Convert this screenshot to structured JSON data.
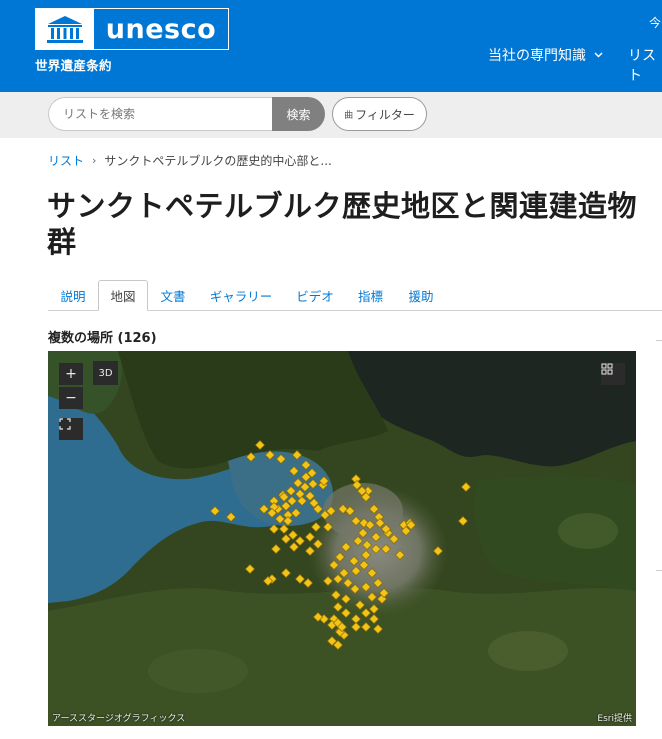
{
  "header": {
    "logo_text": "unesco",
    "subtitle": "世界遺産条約",
    "top_right_text": "今",
    "nav": [
      {
        "label": "当社の専門知識",
        "chevron": "chevron-down-icon"
      },
      {
        "label": "リスト"
      }
    ],
    "background_color": "#0077d4"
  },
  "search": {
    "placeholder": "リストを検索",
    "button_label": "検索",
    "filter_label": "フィルター",
    "filter_icon_text": "曲"
  },
  "breadcrumb": {
    "root": "リスト",
    "separator": "›",
    "current": "サンクトペテルブルクの歴史的中心部と..."
  },
  "page_title": "サンクトペテルブルク歴史地区と関連建造物群",
  "tabs": [
    {
      "label": "説明",
      "active": false
    },
    {
      "label": "地図",
      "active": true
    },
    {
      "label": "文書",
      "active": false
    },
    {
      "label": "ギャラリー",
      "active": false
    },
    {
      "label": "ビデオ",
      "active": false
    },
    {
      "label": "指標",
      "active": false
    },
    {
      "label": "援助",
      "active": false
    }
  ],
  "locations": {
    "title": "複数の場所 (126)"
  },
  "map": {
    "zoom_in": "+",
    "zoom_out": "−",
    "mode_3d": "3D",
    "attribution_left": "アーススタージオグラフィックス",
    "attribution_right": "Esri提供",
    "marker_color": "#f2c419"
  }
}
